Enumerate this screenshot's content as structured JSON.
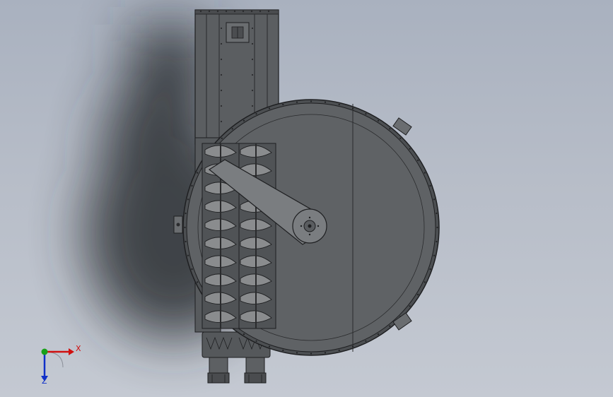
{
  "colors": {
    "background_top": "#a9b1bf",
    "background_bottom": "#c4c9d2",
    "housing_fill": "#5a5d60",
    "housing_stroke": "#1e1f21",
    "drum_fill": "#5e6163",
    "auger_fill": "#8a8c8e",
    "axis_x": "#d01010",
    "axis_y": "#18a018",
    "axis_z": "#1030c8"
  },
  "triad": {
    "x_label": "X",
    "z_label": "Z"
  }
}
